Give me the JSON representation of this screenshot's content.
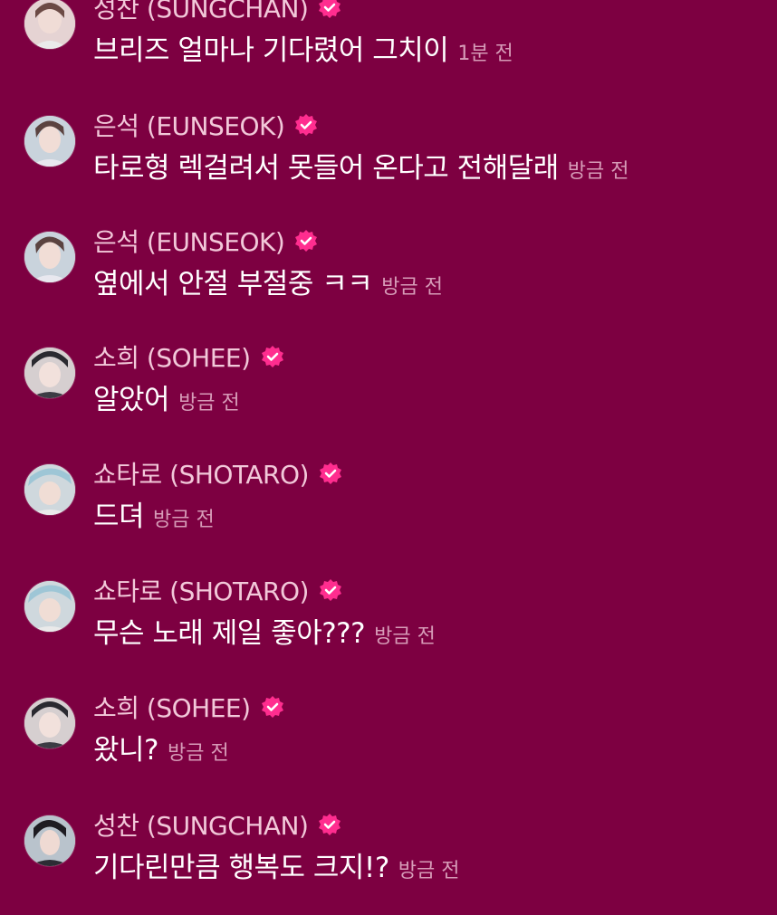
{
  "colors": {
    "background": "#7d0041",
    "name_text": "#f2c8d9",
    "time_text": "#d79cb8",
    "verified_badge": "#ff2d8f"
  },
  "messages": [
    {
      "avatar": "avatar-sungchan",
      "name": "성찬 (SUNGCHAN)",
      "text": "브리즈 얼마나 기다렸어 그치이",
      "time": "1분 전",
      "verified_icon": "verified-badge-icon"
    },
    {
      "avatar": "avatar-eunseok",
      "name": "은석 (EUNSEOK)",
      "text": "타로형 렉걸려서 못들어 온다고 전해달래",
      "time": "방금 전",
      "verified_icon": "verified-badge-icon"
    },
    {
      "avatar": "avatar-eunseok",
      "name": "은석 (EUNSEOK)",
      "text": "옆에서 안절 부절중 ㅋㅋ",
      "time": "방금 전",
      "verified_icon": "verified-badge-icon"
    },
    {
      "avatar": "avatar-sohee",
      "name": "소희 (SOHEE)",
      "text": "알았어",
      "time": "방금 전",
      "verified_icon": "verified-badge-icon"
    },
    {
      "avatar": "avatar-shotaro",
      "name": "쇼타로 (SHOTARO)",
      "text": "드뎌",
      "time": "방금 전",
      "verified_icon": "verified-badge-icon"
    },
    {
      "avatar": "avatar-shotaro",
      "name": "쇼타로 (SHOTARO)",
      "text": "무슨 노래 제일 좋아???",
      "time": "방금 전",
      "verified_icon": "verified-badge-icon"
    },
    {
      "avatar": "avatar-sohee",
      "name": "소희 (SOHEE)",
      "text": "왔니?",
      "time": "방금 전",
      "verified_icon": "verified-badge-icon"
    },
    {
      "avatar": "avatar-sungchan",
      "name": "성찬 (SUNGCHAN)",
      "text": "기다린만큼 행복도 크지!?",
      "time": "방금 전",
      "verified_icon": "verified-badge-icon"
    }
  ]
}
